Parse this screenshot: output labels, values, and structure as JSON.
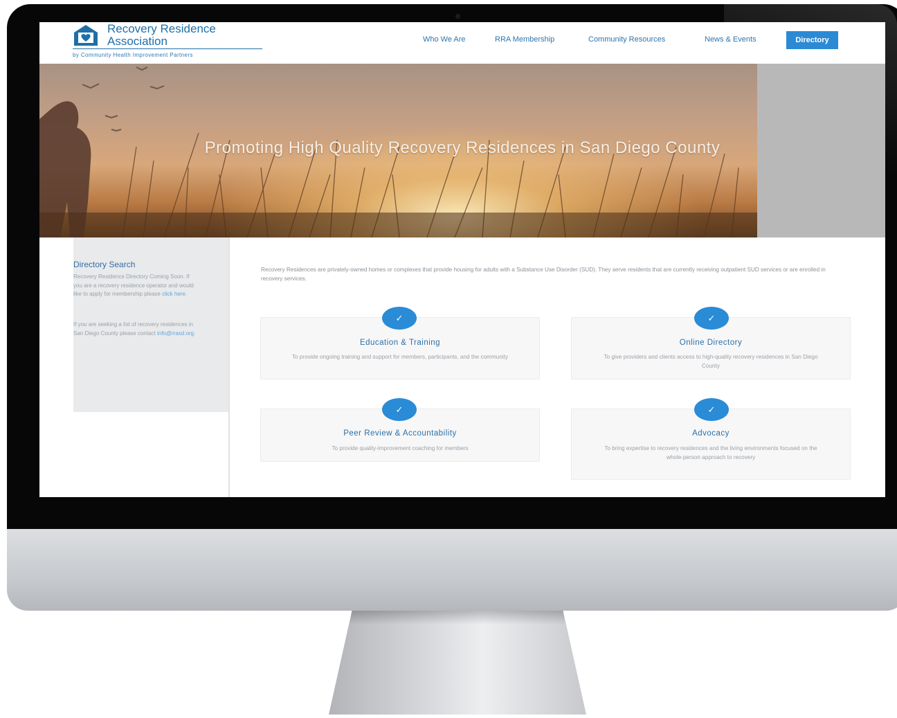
{
  "logo": {
    "title": "Recovery Residence Association",
    "subtitle": "by Community Health Improvement Partners",
    "icon": "house-heart-logo-icon"
  },
  "nav": {
    "items": [
      "Who We Are",
      "RRA Membership",
      "Community Resources",
      "News & Events"
    ],
    "directory_button": "Directory"
  },
  "hero": {
    "headline": "Promoting High Quality Recovery Residences in San Diego County"
  },
  "sidebar": {
    "title": "Directory Search",
    "para1_text": "Recovery Residence Directory Coming Soon. If you are a recovery residence operator and would like to apply for membership please ",
    "para1_link": "click here",
    "para1_end": ".",
    "para2_text": "If you are seeking a list of recovery residences in San Diego County please contact ",
    "para2_link": "info@rrasd.org",
    "para2_end": "."
  },
  "intro": "Recovery Residences are privately-owned homes or complexes that provide housing for adults with a Substance Use Disorder (SUD). They serve residents that are currently receiving outpatient SUD services or are enrolled in recovery services.",
  "cards": [
    {
      "title": "Education & Training",
      "desc": "To provide ongoing training and support for members, participants, and the community",
      "icon": "checkmark-icon"
    },
    {
      "title": "Online Directory",
      "desc": "To give providers and clients access to high-quality recovery residences in San Diego County",
      "icon": "checkmark-icon"
    },
    {
      "title": "Peer Review & Accountability",
      "desc": "To provide quality-improvement coaching for members",
      "icon": "checkmark-icon"
    },
    {
      "title": "Advocacy",
      "desc": "To bring expertise to recovery residences and the living environments focused on the whole-person approach to recovery",
      "icon": "checkmark-icon"
    }
  ],
  "colors": {
    "brand_blue": "#1f6fa7",
    "button_blue": "#2b8ad3",
    "check_blue": "#2a8bd6"
  }
}
